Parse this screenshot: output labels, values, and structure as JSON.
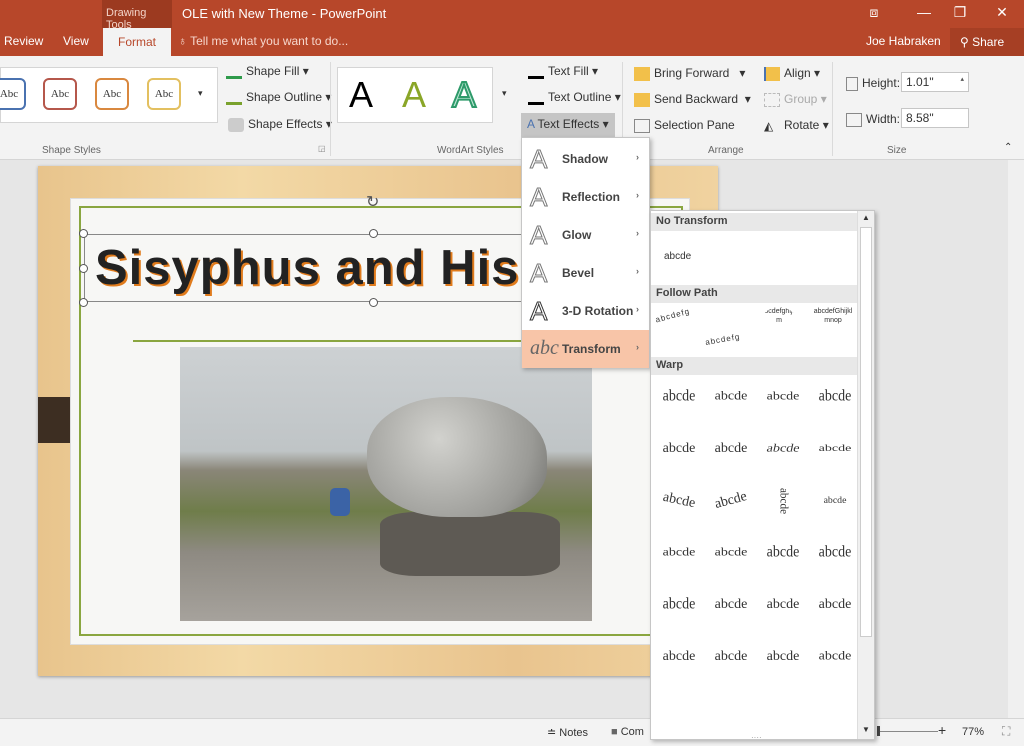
{
  "window": {
    "context_tab": "Drawing Tools",
    "title": "OLE with New Theme - PowerPoint",
    "user": "Joe Habraken",
    "share": "Share"
  },
  "tabs": [
    "Review",
    "View",
    "Format"
  ],
  "tell_me": "Tell me what you want to do...",
  "ribbon": {
    "shape_styles": {
      "label": "Shape Styles",
      "swatch_text": "Abc",
      "swatch_colors": [
        "#4a72b0",
        "#b5574b",
        "#d9883f",
        "#e3c060"
      ],
      "shape_fill": "Shape Fill",
      "shape_outline": "Shape Outline",
      "shape_effects": "Shape Effects"
    },
    "wordart": {
      "label": "WordArt Styles",
      "glyph": "A",
      "text_fill": "Text Fill",
      "text_outline": "Text Outline",
      "text_effects": "Text Effects"
    },
    "arrange": {
      "label": "Arrange",
      "bring_forward": "Bring Forward",
      "send_backward": "Send Backward",
      "selection_pane": "Selection Pane",
      "align": "Align",
      "group": "Group",
      "rotate": "Rotate"
    },
    "size": {
      "label": "Size",
      "height_label": "Height:",
      "height": "1.01\"",
      "width_label": "Width:",
      "width": "8.58\""
    }
  },
  "slide": {
    "title": "Sisyphus and His"
  },
  "text_effects_menu": [
    {
      "label": "Shadow",
      "icon": "A"
    },
    {
      "label": "Reflection",
      "icon": "A"
    },
    {
      "label": "Glow",
      "icon": "A"
    },
    {
      "label": "Bevel",
      "icon": "A"
    },
    {
      "label": "3-D Rotation",
      "icon": "A"
    },
    {
      "label": "Transform",
      "icon": "abc"
    }
  ],
  "transform_gallery": {
    "no_transform": "No Transform",
    "sample": "abcde",
    "follow_path": "Follow Path",
    "follow_path_samples": [
      "abcdefg",
      "abcdefg",
      "abcdefghijklm",
      "abcdefGhijklmnop"
    ],
    "warp": "Warp"
  },
  "status": {
    "notes": "Notes",
    "comments": "Com",
    "zoom": "77%"
  }
}
